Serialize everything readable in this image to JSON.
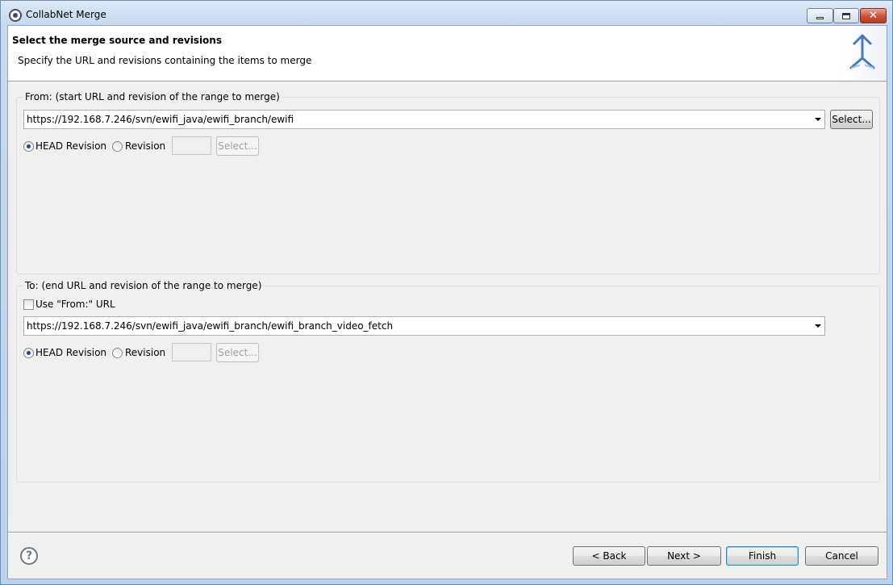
{
  "window": {
    "title": "CollabNet Merge",
    "icon": "eclipse-gear-icon"
  },
  "banner": {
    "title": "Select the merge source and revisions",
    "description": "Specify the URL and revisions containing the items to merge",
    "icon": "merge-arrows-icon"
  },
  "from": {
    "legend": "From: (start URL and revision of the range to merge)",
    "url": "https://192.168.7.246/svn/ewifi_java/ewifi_branch/ewifi",
    "select_label": "Select...",
    "head_label": "HEAD Revision",
    "head_selected": true,
    "revision_label": "Revision",
    "revision_value": "",
    "revision_select_label": "Select..."
  },
  "to": {
    "legend": "To: (end URL and revision of the range to merge)",
    "use_from_label": "Use \"From:\" URL",
    "use_from_checked": false,
    "url": "https://192.168.7.246/svn/ewifi_java/ewifi_branch/ewifi_branch_video_fetch",
    "head_label": "HEAD Revision",
    "head_selected": true,
    "revision_label": "Revision",
    "revision_value": "",
    "revision_select_label": "Select..."
  },
  "footer": {
    "help": "?",
    "back": "< Back",
    "next": "Next >",
    "finish": "Finish",
    "cancel": "Cancel"
  },
  "colors": {
    "accent": "#2c4a7a",
    "frame": "#b9d1ea",
    "dialog_bg": "#f0f0f0"
  }
}
